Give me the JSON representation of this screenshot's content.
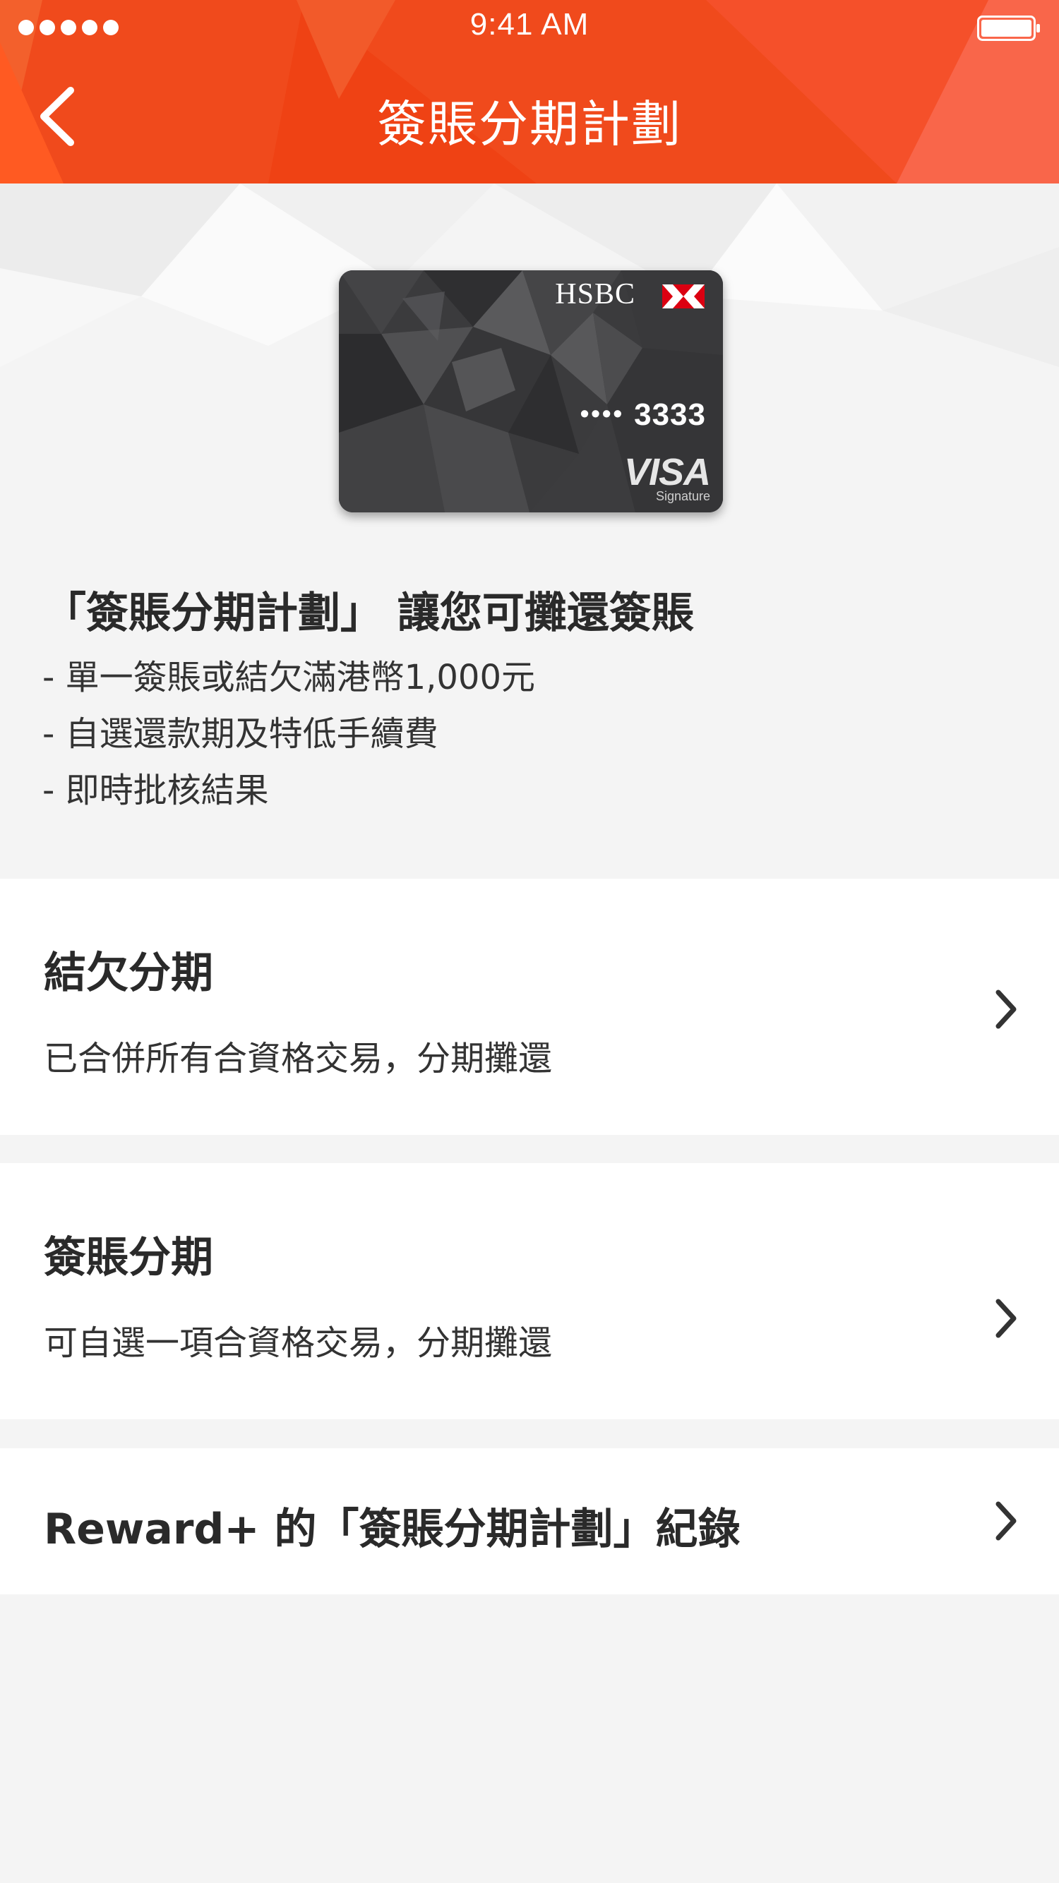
{
  "status_bar": {
    "time": "9:41 AM",
    "signal_icon": "signal-dots-icon",
    "battery_icon": "battery-icon"
  },
  "header": {
    "title": "簽賬分期計劃",
    "back_icon": "chevron-left-icon",
    "color": "#f04a1c"
  },
  "card": {
    "bank_name": "HSBC",
    "number_mask": "••••",
    "number_last4": "3333",
    "network": "VISA",
    "tier": "Signature"
  },
  "intro": {
    "title": "「簽賬分期計劃」 讓您可攤還簽賬",
    "bullets": [
      "- 單一簽賬或結欠滿港幣1,000元",
      "- 自選還款期及特低手續費",
      "- 即時批核結果"
    ]
  },
  "options": [
    {
      "title": "結欠分期",
      "description": "已合併所有合資格交易，分期攤還"
    },
    {
      "title": "簽賬分期",
      "description": "可自選一項合資格交易，分期攤還"
    },
    {
      "title": "Reward+ 的「簽賬分期計劃」紀錄"
    }
  ]
}
